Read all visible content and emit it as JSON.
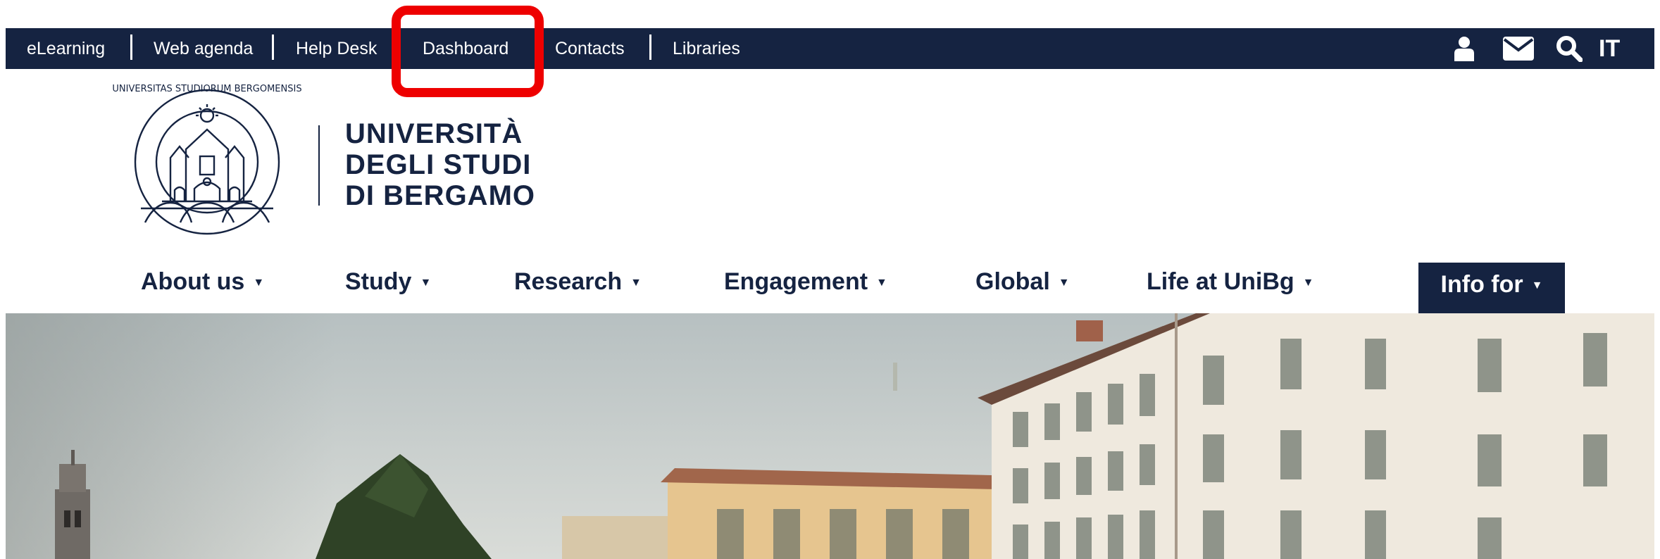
{
  "topbar": {
    "links": [
      {
        "label": "eLearning"
      },
      {
        "label": "Web agenda"
      },
      {
        "label": "Help Desk"
      },
      {
        "label": "Dashboard"
      },
      {
        "label": "Contacts"
      },
      {
        "label": "Libraries"
      }
    ],
    "icons": [
      "user-icon",
      "mail-icon",
      "search-icon"
    ],
    "language": "IT"
  },
  "logo": {
    "seal_text": "UNIVERSITAS STUDIORUM BERGOMENSIS",
    "line1": "UNIVERSITÀ",
    "line2": "DEGLI STUDI",
    "line3": "DI BERGAMO"
  },
  "mainnav": {
    "items": [
      {
        "label": "About us"
      },
      {
        "label": "Study"
      },
      {
        "label": "Research"
      },
      {
        "label": "Engagement"
      },
      {
        "label": "Global"
      },
      {
        "label": "Life at UniBg"
      },
      {
        "label": "Info for"
      }
    ]
  },
  "colors": {
    "navy": "#152341",
    "highlight": "#ee0000"
  }
}
